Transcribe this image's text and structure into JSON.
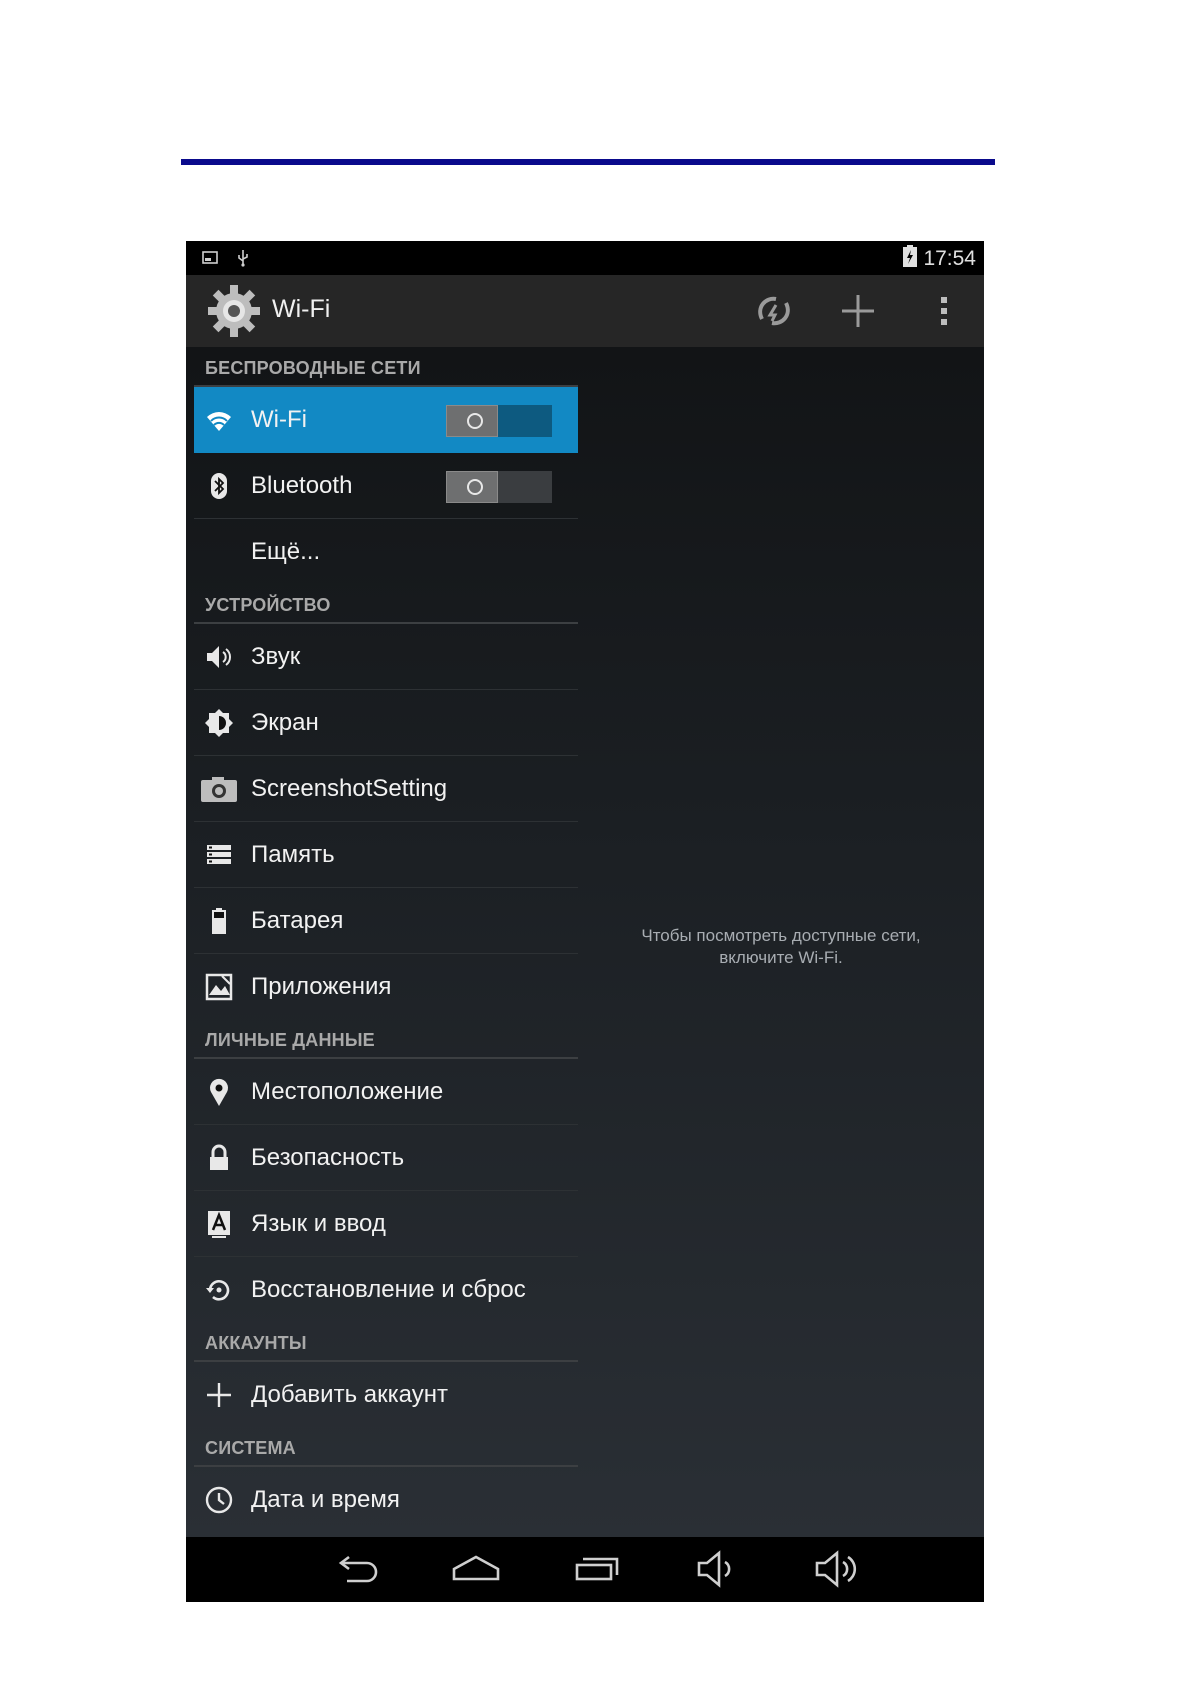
{
  "colors": {
    "rule": "#0a0a8c",
    "accent": "#1289c4"
  },
  "status_bar": {
    "time": "17:54",
    "icons": [
      "screenshot-icon",
      "usb-icon",
      "battery-charging-icon"
    ]
  },
  "action_bar": {
    "title": "Wi-Fi",
    "icons": [
      "settings-gear-icon",
      "wps-icon",
      "add-network-icon",
      "overflow-menu-icon"
    ]
  },
  "sections": [
    {
      "header": "БЕСПРОВОДНЫЕ СЕТИ",
      "items": [
        {
          "label": "Wi-Fi",
          "icon": "wifi-icon",
          "toggle": "off",
          "active": true
        },
        {
          "label": "Bluetooth",
          "icon": "bluetooth-icon",
          "toggle": "off"
        },
        {
          "label": "Ещё..."
        }
      ]
    },
    {
      "header": "УСТРОЙСТВО",
      "items": [
        {
          "label": "Звук",
          "icon": "sound-icon"
        },
        {
          "label": "Экран",
          "icon": "display-icon"
        },
        {
          "label": "ScreenshotSetting",
          "icon": "camera-icon"
        },
        {
          "label": "Память",
          "icon": "storage-icon"
        },
        {
          "label": "Батарея",
          "icon": "battery-icon"
        },
        {
          "label": "Приложения",
          "icon": "apps-icon"
        }
      ]
    },
    {
      "header": "ЛИЧНЫЕ ДАННЫЕ",
      "items": [
        {
          "label": "Местоположение",
          "icon": "location-icon"
        },
        {
          "label": "Безопасность",
          "icon": "lock-icon"
        },
        {
          "label": "Язык и ввод",
          "icon": "language-icon"
        },
        {
          "label": "Восстановление и сброс",
          "icon": "restore-icon"
        }
      ]
    },
    {
      "header": "АККАУНТЫ",
      "items": [
        {
          "label": "Добавить аккаунт",
          "icon": "add-icon"
        }
      ]
    },
    {
      "header": "СИСТЕМА",
      "items": [
        {
          "label": "Дата и время",
          "icon": "clock-icon"
        }
      ]
    }
  ],
  "detail": {
    "message_line1": "Чтобы посмотреть доступные сети,",
    "message_line2": "включите Wi-Fi."
  },
  "nav_bar": {
    "icons": [
      "back-icon",
      "home-icon",
      "recents-icon",
      "volume-down-icon",
      "volume-up-icon"
    ]
  }
}
